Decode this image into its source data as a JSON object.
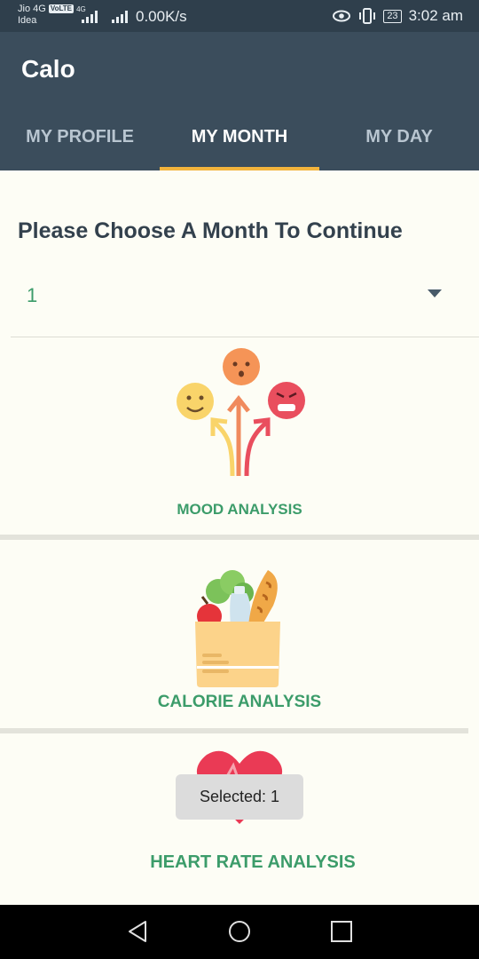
{
  "status_bar": {
    "carrier_line1": "Jio 4G",
    "volte": "VoLTE",
    "network_type": "4G",
    "carrier_line2": "Idea",
    "speed": "0.00K/s",
    "battery_level": "23",
    "time": "3:02 am"
  },
  "app": {
    "title": "Calo",
    "tabs": [
      {
        "label": "MY PROFILE",
        "active": false
      },
      {
        "label": "MY MONTH",
        "active": true
      },
      {
        "label": "MY DAY",
        "active": false
      }
    ]
  },
  "main": {
    "prompt": "Please Choose A Month To Continue",
    "month_select": {
      "value": "1"
    },
    "cards": [
      {
        "label": "MOOD ANALYSIS",
        "icon": "mood-arrows-icon"
      },
      {
        "label": "CALORIE ANALYSIS",
        "icon": "grocery-bag-icon"
      },
      {
        "label": "HEART RATE ANALYSIS",
        "icon": "heart-icon"
      }
    ]
  },
  "toast": {
    "text": "Selected: 1"
  },
  "colors": {
    "app_bar": "#3b4d5c",
    "tab_indicator": "#f3b43c",
    "accent_green": "#3c9c6a",
    "background": "#fdfdf5"
  }
}
